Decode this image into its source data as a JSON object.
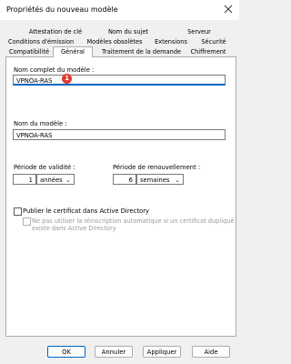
{
  "window": {
    "title": "Propriétés du nouveau modèle"
  },
  "tabs": {
    "row1": [
      "Attestation de clé",
      "Nom du sujet",
      "Serveur"
    ],
    "row2": [
      "Conditions d'émission",
      "Modèles obsolètes",
      "Extensions",
      "Sécurité"
    ],
    "row3": [
      "Compatibilité",
      "Général",
      "Traitement de la demande",
      "Chiffrement"
    ],
    "active": "Général"
  },
  "general": {
    "full_name_label": "Nom complet du modèle :",
    "full_name_value": "VPNOA-RAS",
    "badge": "1",
    "name_label": "Nom du modèle :",
    "name_value": "VPNOA-RAS",
    "validity_label": "Période de validité :",
    "validity_value": "1",
    "validity_unit": "années",
    "renewal_label": "Période de renouvellement :",
    "renewal_value": "6",
    "renewal_unit": "semaines",
    "publish_label": "Publier le certificat dans Active Directory",
    "publish_checked": false,
    "reenroll_label_line1": "Ne pas utiliser la réinscription automatique si un certificat dupliqué",
    "reenroll_label_line2": "existe dans Active Directory",
    "reenroll_checked": false
  },
  "buttons": {
    "ok": "OK",
    "cancel": "Annuler",
    "apply": "Appliquer",
    "help": "Aide"
  },
  "colors": {
    "accent": "#0067c0",
    "badge": "#e03a2f"
  }
}
